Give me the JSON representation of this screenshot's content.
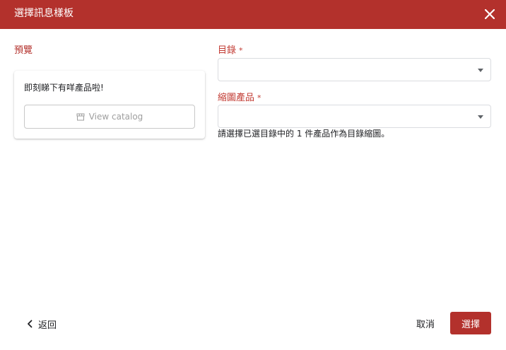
{
  "header": {
    "title": "選擇訊息樣板",
    "close_icon": "close-icon"
  },
  "preview": {
    "label": "預覽",
    "message": "即刻睇下有咩產品啦!",
    "button_label": "View catalog",
    "button_icon": "storefront-icon"
  },
  "form": {
    "catalog": {
      "label": "目錄",
      "required_mark": "*",
      "value": ""
    },
    "thumbnail_product": {
      "label": "縮圖產品",
      "required_mark": "*",
      "value": "",
      "helper": "請選擇已選目錄中的 1 件產品作為目錄縮圖。"
    }
  },
  "footer": {
    "back_label": "返回",
    "cancel_label": "取消",
    "select_label": "選擇"
  },
  "colors": {
    "brand": "#b3312c",
    "label_red": "#c23b33"
  }
}
